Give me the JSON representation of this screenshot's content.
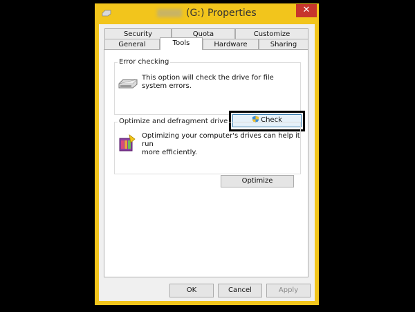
{
  "window": {
    "title_redacted": "",
    "title": "(G:) Properties",
    "close_glyph": "✕"
  },
  "tabs": {
    "row1": [
      "Security",
      "Quota",
      "Customize"
    ],
    "row2": [
      "General",
      "Tools",
      "Hardware",
      "Sharing"
    ],
    "active": "Tools"
  },
  "error_checking": {
    "group_label": "Error checking",
    "description_line1": "This option will check the drive for file",
    "description_line2": "system errors.",
    "check_label": "Check",
    "icon": "drive-icon",
    "button_icon": "shield-icon"
  },
  "optimize": {
    "group_label": "Optimize and defragment drive",
    "description_line1": "Optimizing your computer's drives can help it run",
    "description_line2": "more efficiently.",
    "optimize_label": "Optimize",
    "icon": "defrag-icon"
  },
  "footer": {
    "ok_label": "OK",
    "cancel_label": "Cancel",
    "apply_label": "Apply"
  },
  "colors": {
    "frame": "#f2c51c",
    "close": "#c7352c",
    "background": "#000000"
  }
}
